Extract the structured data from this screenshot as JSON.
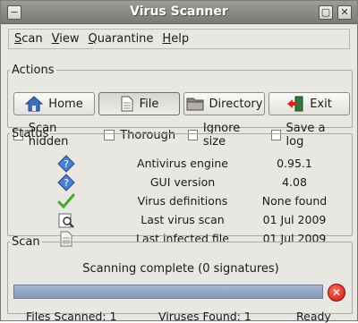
{
  "window": {
    "title": "Virus Scanner"
  },
  "menu": [
    "Scan",
    "View",
    "Quarantine",
    "Help"
  ],
  "menu_mnemonic": [
    "S",
    "V",
    "Q",
    "H"
  ],
  "actions": {
    "legend": "Actions",
    "buttons": [
      "Home",
      "File",
      "Directory",
      "Exit"
    ],
    "checks": [
      "Scan hidden",
      "Thorough",
      "Ignore size",
      "Save a log"
    ]
  },
  "status": {
    "legend": "Status",
    "rows": [
      {
        "label": "Antivirus engine",
        "value": "0.95.1",
        "icon": "info-icon"
      },
      {
        "label": "GUI version",
        "value": "4.08",
        "icon": "info-icon"
      },
      {
        "label": "Virus definitions",
        "value": "None found",
        "icon": "checkmark-icon"
      },
      {
        "label": "Last virus scan",
        "value": "01 Jul 2009",
        "icon": "scan-icon"
      },
      {
        "label": "Last infected file",
        "value": "01 Jul 2009",
        "icon": "document-icon"
      }
    ]
  },
  "scan": {
    "legend": "Scan",
    "message": "Scanning complete (0 signatures)",
    "progress": 1.0,
    "files_scanned": "Files Scanned: 1",
    "viruses_found": "Viruses Found: 1",
    "state": "Ready"
  },
  "colors": {
    "progress": "#8ea0bd",
    "stop": "#d6241a",
    "check": "#4aa531"
  }
}
